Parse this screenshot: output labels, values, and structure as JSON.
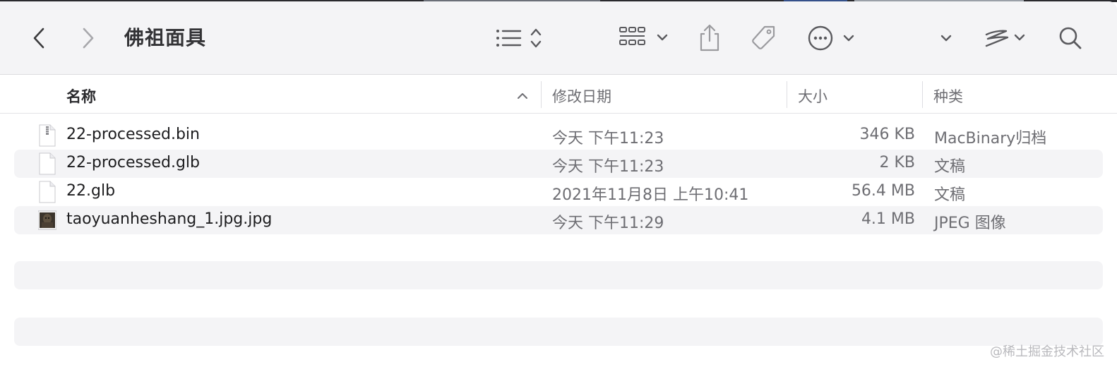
{
  "window": {
    "title": "佛祖面具"
  },
  "toolbar": {
    "back_icon": "chevron-left-icon",
    "forward_icon": "chevron-right-icon",
    "view_icon": "list-view-icon",
    "group_icon": "grid-group-icon",
    "share_icon": "share-icon",
    "tag_icon": "tag-icon",
    "more_icon": "ellipsis-circle-icon",
    "search_icon": "search-icon"
  },
  "columns": {
    "name": "名称",
    "date": "修改日期",
    "size": "大小",
    "kind": "种类"
  },
  "files": [
    {
      "name": "22-processed.bin",
      "date": "今天 下午11:23",
      "size": "346 KB",
      "kind": "MacBinary归档",
      "icon": "archive-file-icon"
    },
    {
      "name": "22-processed.glb",
      "date": "今天 下午11:23",
      "size": "2 KB",
      "kind": "文稿",
      "icon": "document-file-icon"
    },
    {
      "name": "22.glb",
      "date": "2021年11月8日 上午10:41",
      "size": "56.4 MB",
      "kind": "文稿",
      "icon": "document-file-icon"
    },
    {
      "name": "taoyuanheshang_1.jpg.jpg",
      "date": "今天 下午11:29",
      "size": "4.1 MB",
      "kind": "JPEG 图像",
      "icon": "image-thumbnail-icon"
    }
  ],
  "watermark": "@稀土掘金技术社区",
  "colors": {
    "toolbar_bg": "#f4f4f6",
    "row_alt_bg": "#f4f4f6",
    "secondary_text": "#6e6e73"
  }
}
